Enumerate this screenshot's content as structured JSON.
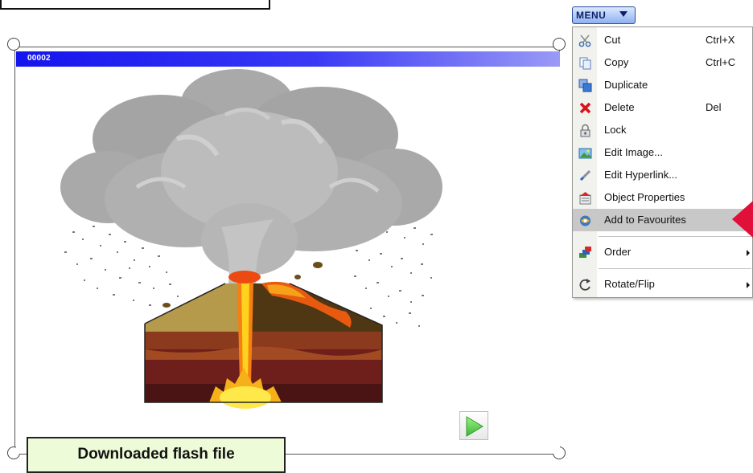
{
  "window": {
    "title": "00002"
  },
  "menu_button": {
    "label": "MENU"
  },
  "context_menu": {
    "items": [
      {
        "label": "Cut",
        "shortcut": "Ctrl+X",
        "icon": "scissors-icon"
      },
      {
        "label": "Copy",
        "shortcut": "Ctrl+C",
        "icon": "copy-icon"
      },
      {
        "label": "Duplicate",
        "shortcut": "",
        "icon": "duplicate-icon"
      },
      {
        "label": "Delete",
        "shortcut": "Del",
        "icon": "delete-x-icon"
      },
      {
        "label": "Lock",
        "shortcut": "",
        "icon": "lock-icon"
      },
      {
        "label": "Edit Image...",
        "shortcut": "",
        "icon": "edit-image-icon"
      },
      {
        "label": "Edit Hyperlink...",
        "shortcut": "",
        "icon": "hyperlink-icon"
      },
      {
        "label": "Object Properties",
        "shortcut": "",
        "icon": "properties-icon"
      },
      {
        "label": "Add to Favourites",
        "shortcut": "",
        "icon": "favourites-icon",
        "highlighted": true
      },
      {
        "label": "Order",
        "shortcut": "",
        "icon": "order-icon",
        "submenu": true
      },
      {
        "label": "Rotate/Flip",
        "shortcut": "",
        "icon": "rotate-icon",
        "submenu": true
      }
    ]
  },
  "caption": {
    "text": "Downloaded flash file"
  },
  "colors": {
    "titlebar_start": "#1414ee",
    "titlebar_end": "#9a9af7",
    "menu_highlight": "#c8c8c8",
    "pointer": "#e0103a",
    "caption_bg": "#eefbd8"
  }
}
